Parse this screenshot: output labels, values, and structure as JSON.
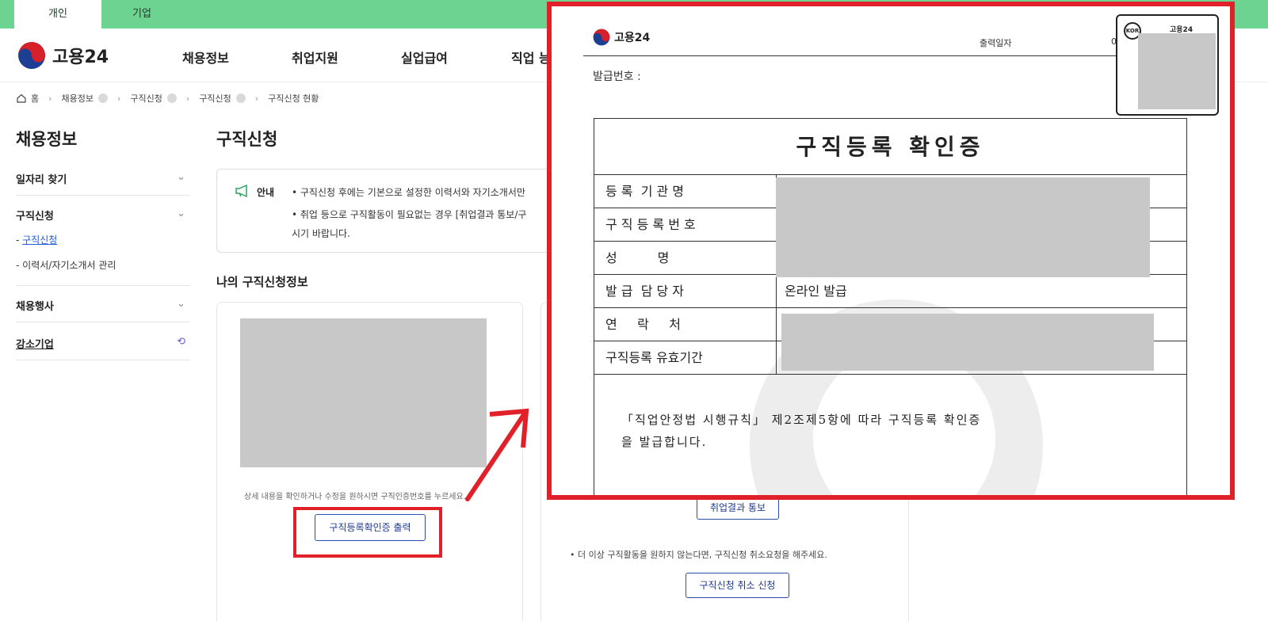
{
  "top_tabs": [
    {
      "label": "개인"
    },
    {
      "label": "기업"
    }
  ],
  "header": {
    "logo_text": "고용24",
    "nav": [
      {
        "label": "채용정보"
      },
      {
        "label": "취업지원"
      },
      {
        "label": "실업급여"
      },
      {
        "label": "직업 능"
      }
    ]
  },
  "breadcrumb": [
    "홈",
    "채용정보",
    "구직신청",
    "구직신청",
    "구직신청 현황"
  ],
  "sidebar": {
    "title": "채용정보",
    "items": [
      {
        "label": "일자리 찾기"
      },
      {
        "label": "구직신청",
        "subs": [
          {
            "label": "구직신청"
          },
          {
            "label": "이력서/자기소개서 관리"
          }
        ]
      },
      {
        "label": "채용행사"
      },
      {
        "label": "강소기업"
      }
    ]
  },
  "main": {
    "title": "구직신청",
    "notice": {
      "label": "안내",
      "lines": [
        "• 구직신청 후에는 기본으로 설정한 이력서와 자기소개서만",
        "• 취업 등으로 구직활동이 필요없는 경우 [취업결과 통보/구",
        "시기 바랍니다."
      ]
    },
    "section_title": "나의 구직신청정보",
    "card1": {
      "help_text": "상세 내용을 확인하거나 수정을 원하시면 구직인증번호를 누르세요.",
      "button": "구직등록확인증 출력"
    },
    "card2": {
      "button_result": "취업결과 통보",
      "cancel_text": "• 더 이상 구직활동을 원하지 않는다면, 구직신청 취소요청을 해주세요.",
      "button_cancel": "구직신청 취소 신청"
    }
  },
  "certificate": {
    "logo_text": "고용24",
    "print_date_label": "출력일자",
    "print_date_value": "0",
    "issue_no_label": "발급번호 :",
    "stamp_label": "고용24",
    "stamp_badge": "KOR",
    "title": "구직등록 확인증",
    "rows": [
      {
        "key": "등 록  기 관 명",
        "value": ""
      },
      {
        "key": "구 직 등 록 번 호",
        "value": ""
      },
      {
        "key": "성          명",
        "value": ""
      },
      {
        "key": "발 급  담 당 자",
        "value": "온라인 발급"
      },
      {
        "key": "연     락     처",
        "value": ""
      },
      {
        "key": "구직등록 유효기간",
        "value": ""
      }
    ],
    "statement_line1": "「직업안정법 시행규칙」  제2조제5항에 따라 구직등록 확인증",
    "statement_line2": "을 발급합니다."
  },
  "colors": {
    "tab_bar": "#6dd391",
    "highlight": "#e0212a",
    "link": "#1f5bd8",
    "button_border": "#2d4ea8"
  }
}
